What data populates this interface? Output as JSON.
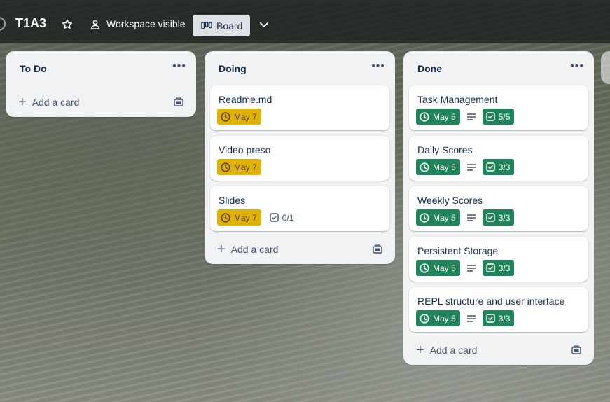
{
  "header": {
    "board_title": "T1A3",
    "visibility_label": "Workspace visible",
    "view_label": "Board"
  },
  "lists": [
    {
      "title": "To Do",
      "add_card_label": "Add a card",
      "cards": []
    },
    {
      "title": "Doing",
      "add_card_label": "Add a card",
      "cards": [
        {
          "title": "Readme.md",
          "due": "May 7",
          "due_status": "due-soon"
        },
        {
          "title": "Video preso",
          "due": "May 7",
          "due_status": "due-soon"
        },
        {
          "title": "Slides",
          "due": "May 7",
          "due_status": "due-soon",
          "checklist": "0/1"
        }
      ]
    },
    {
      "title": "Done",
      "add_card_label": "Add a card",
      "cards": [
        {
          "title": "Task Management",
          "due": "May 5",
          "due_status": "complete",
          "has_description": true,
          "checklist": "5/5"
        },
        {
          "title": "Daily Scores",
          "due": "May 5",
          "due_status": "complete",
          "has_description": true,
          "checklist": "3/3"
        },
        {
          "title": "Weekly Scores",
          "due": "May 5",
          "due_status": "complete",
          "has_description": true,
          "checklist": "3/3"
        },
        {
          "title": "Persistent Storage",
          "due": "May 5",
          "due_status": "complete",
          "has_description": true,
          "checklist": "3/3"
        },
        {
          "title": "REPL structure and user interface",
          "due": "May 5",
          "due_status": "complete",
          "has_description": true,
          "checklist": "3/3"
        }
      ]
    }
  ],
  "colors": {
    "due_soon": "#e2b203",
    "complete": "#1f845a",
    "list_bg": "#f1f2f4",
    "text": "#172b4d"
  },
  "icons": {
    "star": "star-icon",
    "visibility": "people-icon",
    "board": "board-icon",
    "chevron": "chevron-down-icon",
    "clock": "clock-icon",
    "checklist": "checkbox-icon",
    "description": "description-icon",
    "template": "card-template-icon"
  }
}
